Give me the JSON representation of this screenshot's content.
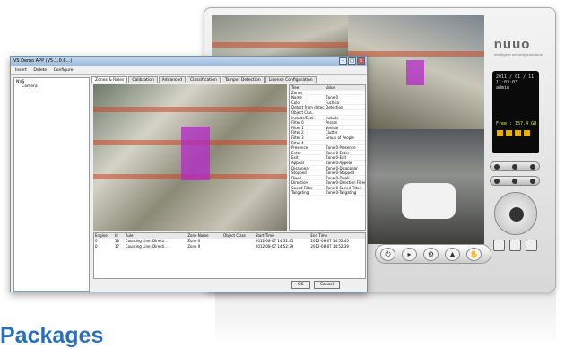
{
  "nvr": {
    "brand": "nuuo",
    "brand_sub": "intelligent security solutions",
    "lcd_date": "2011 / 01 / 11",
    "lcd_time": "11:03:03",
    "lcd_user": "admin",
    "lcd_free": "Free : 157.4 GB",
    "tray_buttons": [
      "power-icon",
      "playback-icon",
      "settings-icon",
      "alert-icon",
      "hand-icon"
    ]
  },
  "window": {
    "title": "VS Demo APP (V5.1.0.6...)",
    "toolbar": [
      "Insert",
      "Delete",
      "Configure"
    ],
    "tree": [
      "NVS",
      "Camera"
    ],
    "tabs": [
      "Zones & Rules",
      "Calibration",
      "Advanced",
      "Classification",
      "Tamper Detection",
      "License Configuration"
    ],
    "props_header": [
      "Tree",
      "Value"
    ],
    "props": [
      [
        "Zones",
        ""
      ],
      [
        "Name",
        "Zone 0"
      ],
      [
        "Color",
        "Fuchsia"
      ],
      [
        "Detect from detec..",
        "Detection"
      ],
      [
        "Object Clas..",
        ""
      ],
      [
        "Include/Excl..",
        "Include"
      ],
      [
        "Filter 0",
        "Person"
      ],
      [
        "Filter 1",
        "Vehicle"
      ],
      [
        "Filter 2",
        "Clutter"
      ],
      [
        "Filter 3",
        "Group of People"
      ],
      [
        "Filter 4",
        ""
      ],
      [
        "Presence",
        "Zone 0-Presence"
      ],
      [
        "Enter",
        "Zone 0-Enter"
      ],
      [
        "Exit",
        "Zone 0-Exit"
      ],
      [
        "Appear",
        "Zone 0-Appear"
      ],
      [
        "Disappear",
        "Zone 0-Disappear"
      ],
      [
        "Stopped",
        "Zone 0-Stopped"
      ],
      [
        "Dwell",
        "Zone 0-Dwell"
      ],
      [
        "Direction",
        "Zone 0-Direction Filter"
      ],
      [
        "Speed Filter",
        "Zone 0-Speed Filter"
      ],
      [
        "Tailgating",
        "Zone 0-Tailgating"
      ]
    ],
    "events_header": [
      "Engine",
      "Id",
      "Rule",
      "Zone Name",
      "Object Class",
      "Start Time",
      "End Time"
    ],
    "events": [
      [
        "0",
        "18",
        "Counting Line: Directi...",
        "Zone 0",
        "",
        "2012-08-07 14:52:45",
        "2012-08-07 14:52:45"
      ],
      [
        "0",
        "17",
        "Counting Line: Directi...",
        "Zone 0",
        "",
        "2012-08-07 14:52:39",
        "2012-08-07 14:52:39"
      ]
    ],
    "ok_label": "OK",
    "cancel_label": "Cancel"
  },
  "heading": "Packages"
}
